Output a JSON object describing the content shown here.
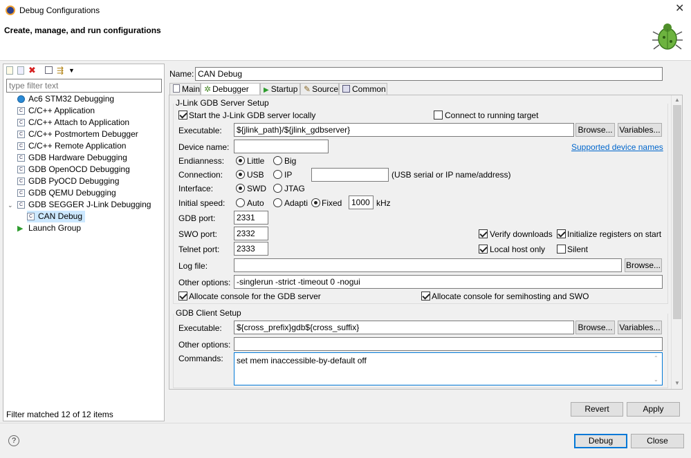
{
  "window": {
    "title": "Debug Configurations",
    "header": "Create, manage, and run configurations"
  },
  "left": {
    "filter_placeholder": "type filter text",
    "items": [
      {
        "label": "Ac6 STM32 Debugging"
      },
      {
        "label": "C/C++ Application"
      },
      {
        "label": "C/C++ Attach to Application"
      },
      {
        "label": "C/C++ Postmortem Debugger"
      },
      {
        "label": "C/C++ Remote Application"
      },
      {
        "label": "GDB Hardware Debugging"
      },
      {
        "label": "GDB OpenOCD Debugging"
      },
      {
        "label": "GDB PyOCD Debugging"
      },
      {
        "label": "GDB QEMU Debugging"
      },
      {
        "label": "GDB SEGGER J-Link Debugging"
      },
      {
        "label": "CAN Debug"
      },
      {
        "label": "Launch Group"
      }
    ],
    "status": "Filter matched 12 of 12 items"
  },
  "name": {
    "label": "Name:",
    "value": "CAN Debug"
  },
  "tabs": [
    {
      "label": "Main"
    },
    {
      "label": "Debugger"
    },
    {
      "label": "Startup"
    },
    {
      "label": "Source"
    },
    {
      "label": "Common"
    }
  ],
  "server": {
    "title": "J-Link GDB Server Setup",
    "start_locally": "Start the J-Link GDB server locally",
    "connect_running": "Connect to running target",
    "exec_label": "Executable:",
    "exec_value": "${jlink_path}/${jlink_gdbserver}",
    "browse": "Browse...",
    "variables": "Variables...",
    "device_label": "Device name:",
    "device_value": "",
    "supported_link": "Supported device names",
    "endianness_label": "Endianness:",
    "little": "Little",
    "big": "Big",
    "connection_label": "Connection:",
    "usb": "USB",
    "ip": "IP",
    "conn_value": "",
    "conn_hint": "(USB serial or IP name/address)",
    "interface_label": "Interface:",
    "swd": "SWD",
    "jtag": "JTAG",
    "speed_label": "Initial speed:",
    "auto": "Auto",
    "adapti": "Adapti",
    "fixed": "Fixed",
    "speed_value": "1000",
    "khz": "kHz",
    "gdb_port_label": "GDB port:",
    "gdb_port": "2331",
    "swo_port_label": "SWO port:",
    "swo_port": "2332",
    "telnet_label": "Telnet port:",
    "telnet_port": "2333",
    "verify": "Verify downloads",
    "init_regs": "Initialize registers on start",
    "local_host": "Local host only",
    "silent": "Silent",
    "log_label": "Log file:",
    "log_value": "",
    "other_label": "Other options:",
    "other_value": "-singlerun -strict -timeout 0 -nogui",
    "alloc_gdb": "Allocate console for the GDB server",
    "alloc_semi": "Allocate console for semihosting and SWO"
  },
  "client": {
    "title": "GDB Client Setup",
    "exec_label": "Executable:",
    "exec_value": "${cross_prefix}gdb${cross_suffix}",
    "other_label": "Other options:",
    "other_value": "",
    "commands_label": "Commands:",
    "commands_value": "set mem inaccessible-by-default off"
  },
  "buttons": {
    "revert": "Revert",
    "apply": "Apply",
    "debug": "Debug",
    "close": "Close",
    "help": "?"
  }
}
